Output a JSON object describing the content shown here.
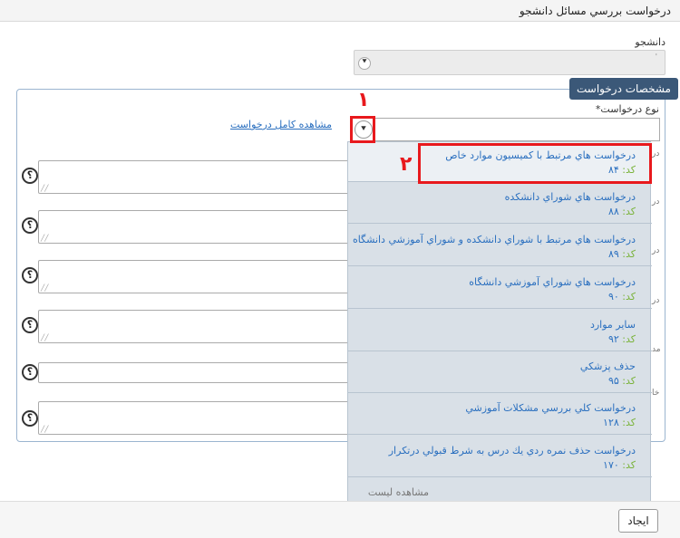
{
  "window": {
    "title": "درخواست بررسي مسائل دانشجو"
  },
  "student": {
    "label": "دانشجو",
    "value": "'"
  },
  "panel": {
    "header": "مشخصات درخواست",
    "request_type_label": "نوع درخواست*",
    "full_view_link": "مشاهده کامل درخواست"
  },
  "help_symbol": "؟",
  "side_labels": [
    "در",
    "در",
    "در",
    "در",
    "مد",
    "خا"
  ],
  "dropdown": {
    "code_prefix": "کد:",
    "options": [
      {
        "title": "درخواست هاي مرتبط با کميسيون موارد خاص",
        "code": "۸۴"
      },
      {
        "title": "درخواست هاي شوراي دانشکده",
        "code": "۸۸"
      },
      {
        "title": "درخواست هاي مرتبط با شوراي دانشکده و شوراي آموزشي دانشگاه",
        "code": "۸۹"
      },
      {
        "title": "درخواست هاي شوراي آموزشي دانشگاه",
        "code": "۹۰"
      },
      {
        "title": "ساير موارد",
        "code": "۹۲"
      },
      {
        "title": "حذف پزشکي",
        "code": "۹۵"
      },
      {
        "title": "درخواست کلي بررسي مشکلات آموزشي",
        "code": "۱۲۸"
      },
      {
        "title": "درخواست حذف نمره ردي يك درس به شرط قبولي درتکرار",
        "code": "۱۷۰"
      }
    ],
    "view_list": "مشاهده ليست"
  },
  "annotations": {
    "step1": "۱",
    "step2": "۲",
    "color": "#e8191d"
  },
  "footer": {
    "create_button": "ایجاد"
  },
  "colors": {
    "panel_header_bg": "#3b5878",
    "link": "#2a6fbf",
    "code_label": "#7ab33a",
    "dropdown_bg": "#d9e0e7"
  }
}
